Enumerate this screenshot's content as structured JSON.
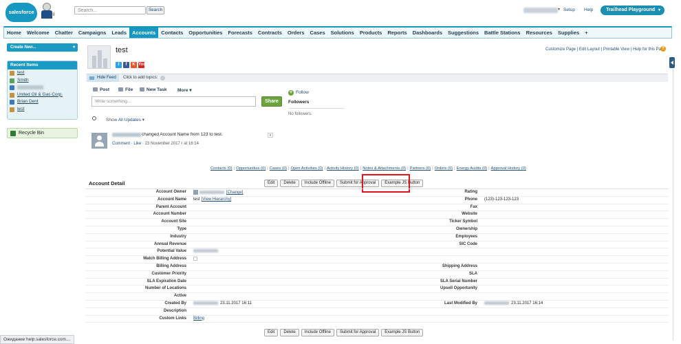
{
  "header": {
    "logo_text": "salesforce",
    "release_label": "18",
    "search_placeholder": "Search...",
    "search_button": "Search",
    "setup_link": "Setup",
    "help_link": "Help",
    "app_menu_label": "Trailhead Playground"
  },
  "tabs": [
    {
      "label": "Home",
      "active": false
    },
    {
      "label": "Welcome",
      "active": false
    },
    {
      "label": "Chatter",
      "active": false
    },
    {
      "label": "Campaigns",
      "active": false
    },
    {
      "label": "Leads",
      "active": false
    },
    {
      "label": "Accounts",
      "active": true
    },
    {
      "label": "Contacts",
      "active": false
    },
    {
      "label": "Opportunities",
      "active": false
    },
    {
      "label": "Forecasts",
      "active": false
    },
    {
      "label": "Contracts",
      "active": false
    },
    {
      "label": "Orders",
      "active": false
    },
    {
      "label": "Cases",
      "active": false
    },
    {
      "label": "Solutions",
      "active": false
    },
    {
      "label": "Products",
      "active": false
    },
    {
      "label": "Reports",
      "active": false
    },
    {
      "label": "Dashboards",
      "active": false
    },
    {
      "label": "Suggestions",
      "active": false
    },
    {
      "label": "Battle Stations",
      "active": false
    },
    {
      "label": "Resources",
      "active": false
    },
    {
      "label": "Supplies",
      "active": false
    },
    {
      "label": "+",
      "active": false
    }
  ],
  "sidebar": {
    "create_new": "Create New...",
    "recent_title": "Recent Items",
    "recent_items": [
      {
        "label": "test",
        "color": "#c9913d"
      },
      {
        "label": "Smith",
        "color": "#5aa25a"
      },
      {
        "label": "",
        "color": "#3a78c0"
      },
      {
        "label": "United Oil & Gas Corp.",
        "color": "#c9913d"
      },
      {
        "label": "Brian Dent",
        "color": "#3a78c0"
      },
      {
        "label": "test",
        "color": "#c9913d"
      }
    ],
    "recycle_bin": "Recycle Bin"
  },
  "account": {
    "name": "test",
    "social": [
      {
        "label": "t",
        "color": "#2aa3ef"
      },
      {
        "label": "f",
        "color": "#3b5998"
      },
      {
        "label": "K",
        "color": "#e8562a"
      },
      {
        "label": "You",
        "color": "#d8271c"
      }
    ],
    "top_links": "Customize Page | Edit Layout | Printable View | Help for this Page",
    "help_icon": "?"
  },
  "feed": {
    "hide_feed": "Hide Feed",
    "add_topics": "Click to add topics:",
    "publisher": {
      "post": "Post",
      "file": "File",
      "new_task": "New Task",
      "more": "More ▾"
    },
    "post_placeholder": "Write something...",
    "share": "Share",
    "show_label": "Show",
    "show_value": "All Updates",
    "follow": "Follow",
    "followers": "Followers",
    "no_followers": "No followers.",
    "item_text": "changed Account Name from 123 to test.",
    "item_comment": "Comment",
    "item_like": "Like",
    "item_date": "23 November 2017 г at 16:14"
  },
  "related_links": [
    "Contacts (0)",
    "Opportunities (0)",
    "Cases (0)",
    "Open Activities (0)",
    "Activity History (0)",
    "Notes & Attachments (0)",
    "Partners (0)",
    "Orders (0)",
    "Energy Audits (0)",
    "Approval History (0)"
  ],
  "detail": {
    "title": "Account Detail",
    "buttons": [
      "Edit",
      "Delete",
      "Include Offline",
      "Submit for Approval",
      "Example JS Button"
    ],
    "rows": [
      {
        "l_label": "Account Owner",
        "l_value": "[Change]",
        "l_kind": "owner",
        "r_label": "Rating",
        "r_value": ""
      },
      {
        "l_label": "Account Name",
        "l_value": "test",
        "l_link": "[View Hierarchy]",
        "r_label": "Phone",
        "r_value": "(123)-123-123-123"
      },
      {
        "l_label": "Parent Account",
        "l_value": "",
        "r_label": "Fax",
        "r_value": ""
      },
      {
        "l_label": "Account Number",
        "l_value": "",
        "r_label": "Website",
        "r_value": ""
      },
      {
        "l_label": "Account Site",
        "l_value": "",
        "r_label": "Ticker Symbol",
        "r_value": ""
      },
      {
        "l_label": "Type",
        "l_value": "",
        "r_label": "Ownership",
        "r_value": ""
      },
      {
        "l_label": "Industry",
        "l_value": "",
        "r_label": "Employees",
        "r_value": ""
      },
      {
        "l_label": "Annual Revenue",
        "l_value": "",
        "r_label": "SIC Code",
        "r_value": ""
      },
      {
        "l_label": "Potential Value",
        "l_value": "",
        "l_kind": "blur",
        "r_label": "",
        "r_value": ""
      },
      {
        "l_label": "Match Billing Address",
        "l_value": "",
        "l_kind": "checkbox",
        "r_label": "",
        "r_value": ""
      },
      {
        "l_label": "Billing Address",
        "l_value": "",
        "r_label": "Shipping Address",
        "r_value": ""
      },
      {
        "l_label": "Customer Priority",
        "l_value": "",
        "r_label": "SLA",
        "r_value": ""
      },
      {
        "l_label": "SLA Expiration Date",
        "l_value": "",
        "r_label": "SLA Serial Number",
        "r_value": ""
      },
      {
        "l_label": "Number of Locations",
        "l_value": "",
        "r_label": "Upsell Opportunity",
        "r_value": ""
      },
      {
        "l_label": "Active",
        "l_value": "",
        "r_label": "",
        "r_value": ""
      },
      {
        "l_label": "Created By",
        "l_value": "23.11.2017 16:11",
        "l_kind": "byline",
        "r_label": "Last Modified By",
        "r_value": "23.11.2017 16:14",
        "r_kind": "byline"
      },
      {
        "l_label": "Description",
        "l_value": "",
        "r_label": "",
        "r_value": ""
      },
      {
        "l_label": "Custom Links",
        "l_value": "",
        "l_link": "Billing",
        "r_label": "",
        "r_value": ""
      }
    ]
  },
  "status_bar": "Ожидание help.salesforce.com..."
}
